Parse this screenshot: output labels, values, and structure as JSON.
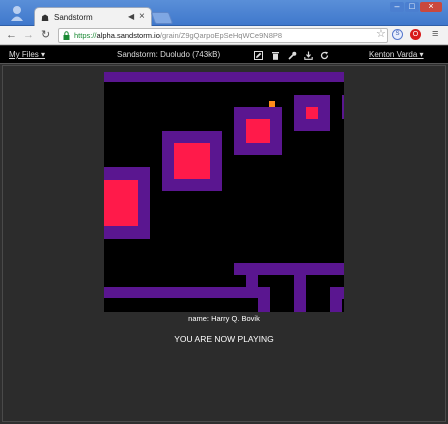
{
  "browser": {
    "tab_title": "Sandstorm",
    "url_scheme": "https://",
    "url_host": "alpha.sandstorm.io",
    "url_path": "/grain/Z9gQarpoEpSeHqWCe9N8P8",
    "audio_icon": "speaker-icon",
    "close_glyph": "×",
    "ext1_label": "S",
    "ext2_label": "O"
  },
  "sandstorm": {
    "my_files": "My Files ▾",
    "grain_title": "Sandstorm: Duoludo (743kB)",
    "user_menu": "Kenton Varda ▾"
  },
  "game": {
    "player_name_line": "name: Harry Q. Bovik",
    "status": "YOU ARE NOW PLAYING",
    "colors": {
      "background": "#000000",
      "wall": "#5a1690",
      "enemy": "#ff1a4a",
      "player": "#ff8c1a"
    }
  }
}
